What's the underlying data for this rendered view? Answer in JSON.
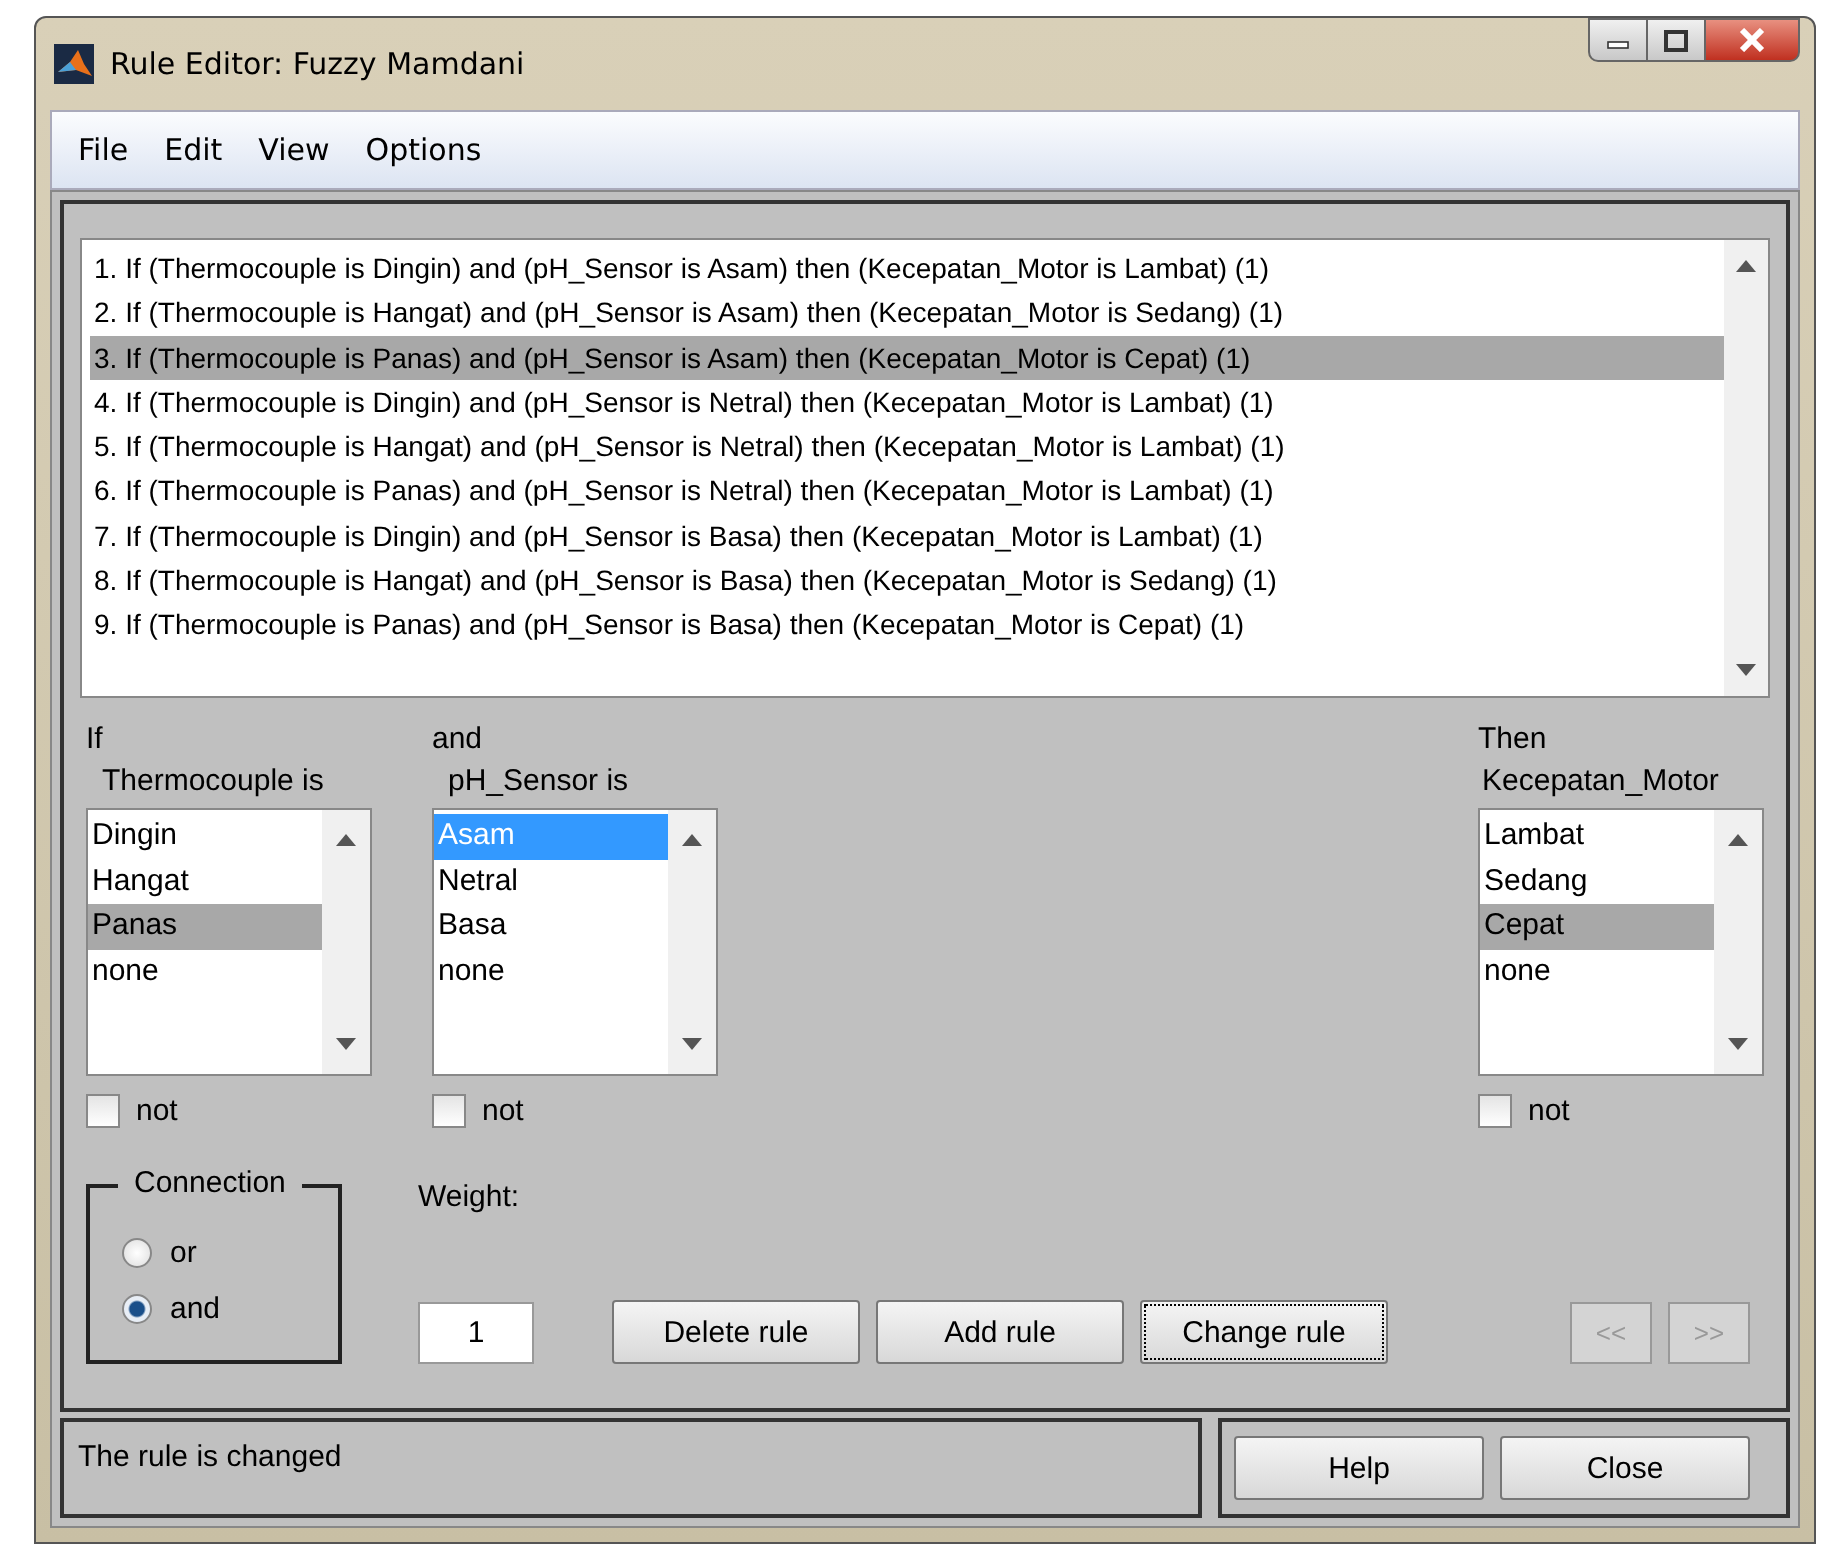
{
  "window": {
    "title": "Rule Editor: Fuzzy Mamdani"
  },
  "menu": [
    "File",
    "Edit",
    "View",
    "Options"
  ],
  "rules": [
    {
      "text": "1. If (Thermocouple is Dingin) and (pH_Sensor is Asam) then (Kecepatan_Motor is Lambat) (1)",
      "selected": false
    },
    {
      "text": "2. If (Thermocouple is Hangat) and (pH_Sensor is Asam) then (Kecepatan_Motor is Sedang) (1)",
      "selected": false
    },
    {
      "text": "3. If (Thermocouple is Panas) and (pH_Sensor is Asam) then (Kecepatan_Motor is Cepat) (1)",
      "selected": true
    },
    {
      "text": "4. If (Thermocouple is Dingin) and (pH_Sensor is Netral) then (Kecepatan_Motor is Lambat) (1)",
      "selected": false
    },
    {
      "text": "5. If (Thermocouple is Hangat) and (pH_Sensor is Netral) then (Kecepatan_Motor is Lambat) (1)",
      "selected": false
    },
    {
      "text": "6. If (Thermocouple is Panas) and (pH_Sensor is Netral) then (Kecepatan_Motor is Lambat) (1)",
      "selected": false
    },
    {
      "text": "7. If (Thermocouple is Dingin) and (pH_Sensor is Basa) then (Kecepatan_Motor is Lambat) (1)",
      "selected": false
    },
    {
      "text": "8. If (Thermocouple is Hangat) and (pH_Sensor is Basa) then (Kecepatan_Motor is Sedang) (1)",
      "selected": false
    },
    {
      "text": "9. If (Thermocouple is Panas) and (pH_Sensor is Basa) then (Kecepatan_Motor is Cepat) (1)",
      "selected": false
    }
  ],
  "columns": [
    {
      "heading": "If",
      "variable": "Thermocouple is",
      "focused": false,
      "not_label": "not",
      "not_checked": false,
      "options": [
        {
          "label": "Dingin",
          "selected": false
        },
        {
          "label": "Hangat",
          "selected": false
        },
        {
          "label": "Panas",
          "selected": true
        },
        {
          "label": "none",
          "selected": false
        }
      ]
    },
    {
      "heading": "and",
      "variable": "pH_Sensor is",
      "focused": true,
      "not_label": "not",
      "not_checked": false,
      "options": [
        {
          "label": "Asam",
          "selected": true
        },
        {
          "label": "Netral",
          "selected": false
        },
        {
          "label": "Basa",
          "selected": false
        },
        {
          "label": "none",
          "selected": false
        }
      ]
    },
    {
      "heading": "Then",
      "variable": "Kecepatan_Motor",
      "focused": false,
      "not_label": "not",
      "not_checked": false,
      "options": [
        {
          "label": "Lambat",
          "selected": false
        },
        {
          "label": "Sedang",
          "selected": false
        },
        {
          "label": "Cepat",
          "selected": true
        },
        {
          "label": "none",
          "selected": false
        }
      ]
    }
  ],
  "connection": {
    "title": "Connection",
    "options": [
      {
        "label": "or",
        "selected": false
      },
      {
        "label": "and",
        "selected": true
      }
    ]
  },
  "weight": {
    "label": "Weight:",
    "value": "1"
  },
  "buttons": [
    {
      "label": "Delete rule",
      "focused": false
    },
    {
      "label": "Add rule",
      "focused": false
    },
    {
      "label": "Change rule",
      "focused": true
    }
  ],
  "nav_buttons": [
    {
      "label": "<<",
      "disabled": true
    },
    {
      "label": ">>",
      "disabled": true
    }
  ],
  "status": "The rule is changed",
  "footer_buttons": [
    "Help",
    "Close"
  ]
}
